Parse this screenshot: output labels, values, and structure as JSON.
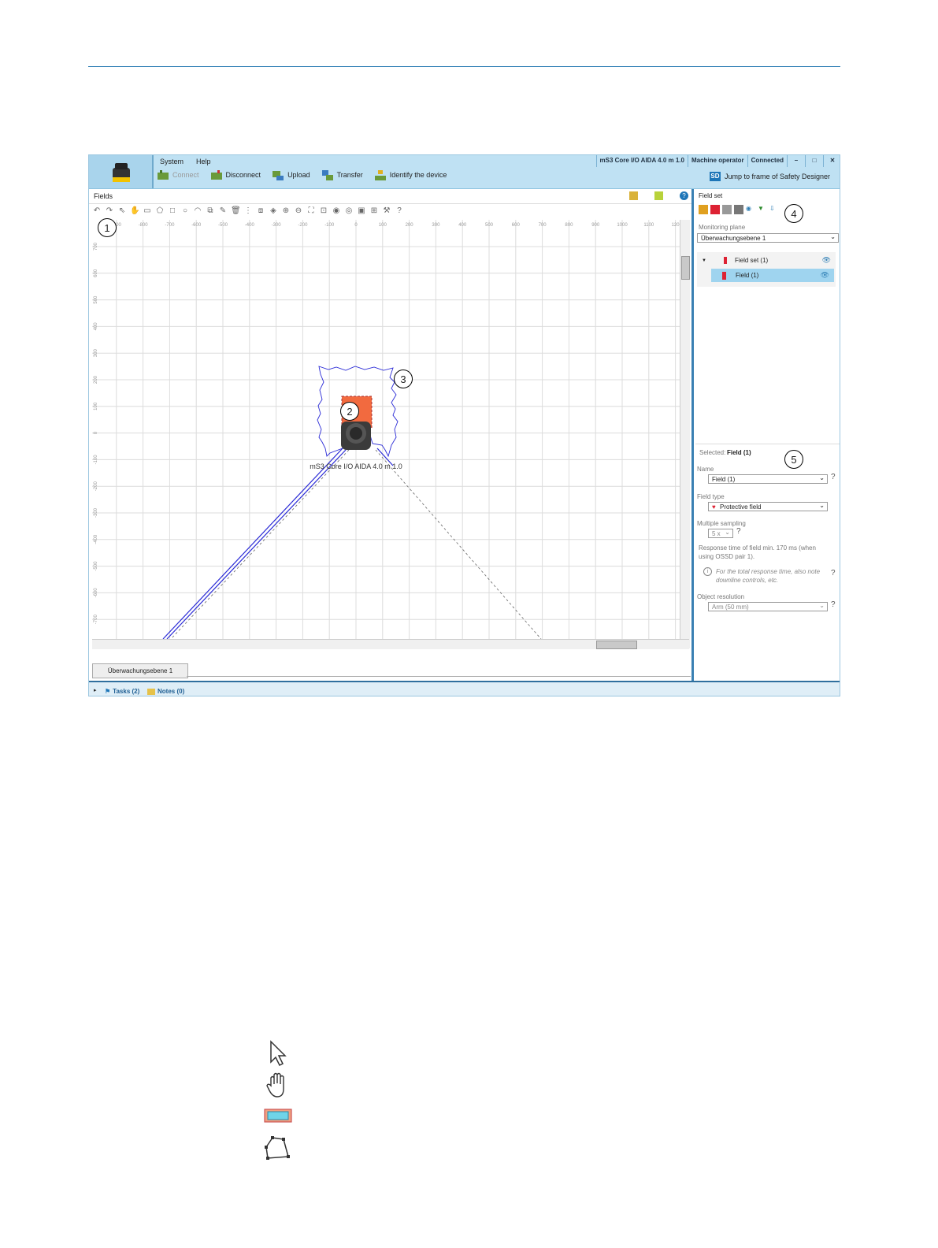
{
  "menu": {
    "system": "System",
    "help": "Help"
  },
  "status": {
    "device": "mS3 Core I/O AIDA 4.0 m 1.0",
    "user": "Machine operator",
    "connection": "Connected"
  },
  "toolbar": {
    "connect": "Connect",
    "disconnect": "Disconnect",
    "upload": "Upload",
    "transfer": "Transfer",
    "identify": "Identify the device",
    "jump": "Jump to frame of Safety Designer",
    "sd": "SD"
  },
  "fields": {
    "title": "Fields",
    "bottom_tab": "Überwachungsebene 1"
  },
  "canvas": {
    "x_ticks": [
      "-900",
      "-800",
      "-700",
      "-600",
      "-500",
      "-400",
      "-300",
      "-200",
      "-100",
      "0",
      "100",
      "200",
      "300",
      "400",
      "500",
      "600",
      "700",
      "800",
      "900",
      "1000",
      "1100",
      "120"
    ],
    "y_ticks": [
      "700",
      "600",
      "500",
      "400",
      "300",
      "200",
      "100",
      "0",
      "-100",
      "-200",
      "-300",
      "-400",
      "-500",
      "-600",
      "-700"
    ],
    "device_label": "mS3 Core I/O AIDA 4.0 m 1.0"
  },
  "field_set": {
    "title": "Field set",
    "monitoring_plane_label": "Monitoring plane",
    "monitoring_plane_value": "Überwachungsebene 1",
    "tree": [
      {
        "label": "Field set (1)"
      },
      {
        "label": "Field (1)"
      }
    ],
    "selected_prefix": "Selected:",
    "selected_value": "Field (1)",
    "name_label": "Name",
    "name_value": "Field (1)",
    "field_type_label": "Field type",
    "field_type_value": "Protective field",
    "multiple_sampling_label": "Multiple sampling",
    "multiple_sampling_value": "5 x",
    "response_time": "Response time of field min. 170 ms (when using OSSD pair 1).",
    "note": "For the total response time, also note downline controls, etc.",
    "object_resolution_label": "Object resolution",
    "object_resolution_value": "Arm (50 mm)"
  },
  "bottom_bar": {
    "tasks": "Tasks (2)",
    "notes": "Notes (0)"
  },
  "callouts": [
    "1",
    "2",
    "3",
    "4",
    "5"
  ],
  "legend_icons": [
    "select-arrow-icon",
    "hand-pan-icon",
    "rectangle-field-icon",
    "polygon-icon"
  ],
  "colors": {
    "accent": "#2f7fb5",
    "title_bar": "#bfe1f3",
    "field_fill": "#f26a3f",
    "contour": "#2a2ad6",
    "selection": "#9fd4ef"
  }
}
